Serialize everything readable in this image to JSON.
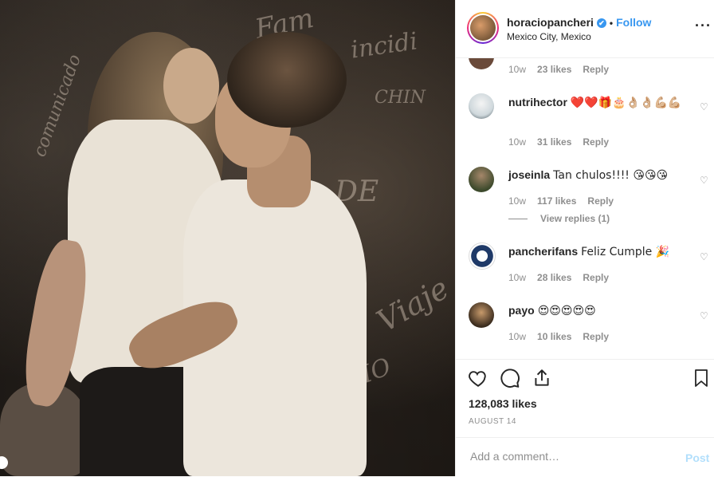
{
  "header": {
    "username": "horaciopancheri",
    "verified_mark": "✔",
    "separator": "•",
    "follow_label": "Follow",
    "location": "Mexico City, Mexico",
    "more_label": "···"
  },
  "comments": [
    {
      "username": "",
      "text": "",
      "time": "10w",
      "likes": "23 likes",
      "reply": "Reply"
    },
    {
      "username": "nutrihector",
      "text": "❤️❤️🎁🎂👌🏼👌🏼💪🏼💪🏼",
      "time": "10w",
      "likes": "31 likes",
      "reply": "Reply"
    },
    {
      "username": "joseinla",
      "text": "Tan chulos!!!! 😘😘😘",
      "time": "10w",
      "likes": "117 likes",
      "reply": "Reply",
      "view_replies": "View replies (1)"
    },
    {
      "username": "pancherifans",
      "text": "Feliz Cumple 🎉",
      "time": "10w",
      "likes": "28 likes",
      "reply": "Reply"
    },
    {
      "username": "payo",
      "text": "😍😍😍😍😍",
      "time": "10w",
      "likes": "10 likes",
      "reply": "Reply"
    }
  ],
  "actions": {
    "like_icon": "heart-icon",
    "comment_icon": "comment-icon",
    "share_icon": "share-icon",
    "save_icon": "bookmark-icon",
    "likes_count": "128,083 likes",
    "date": "AUGUST 14"
  },
  "add_comment": {
    "placeholder": "Add a comment…",
    "post_label": "Post"
  },
  "colors": {
    "accent": "#3897f0",
    "post_disabled": "#b2dffc",
    "muted": "#8e8e8e"
  }
}
